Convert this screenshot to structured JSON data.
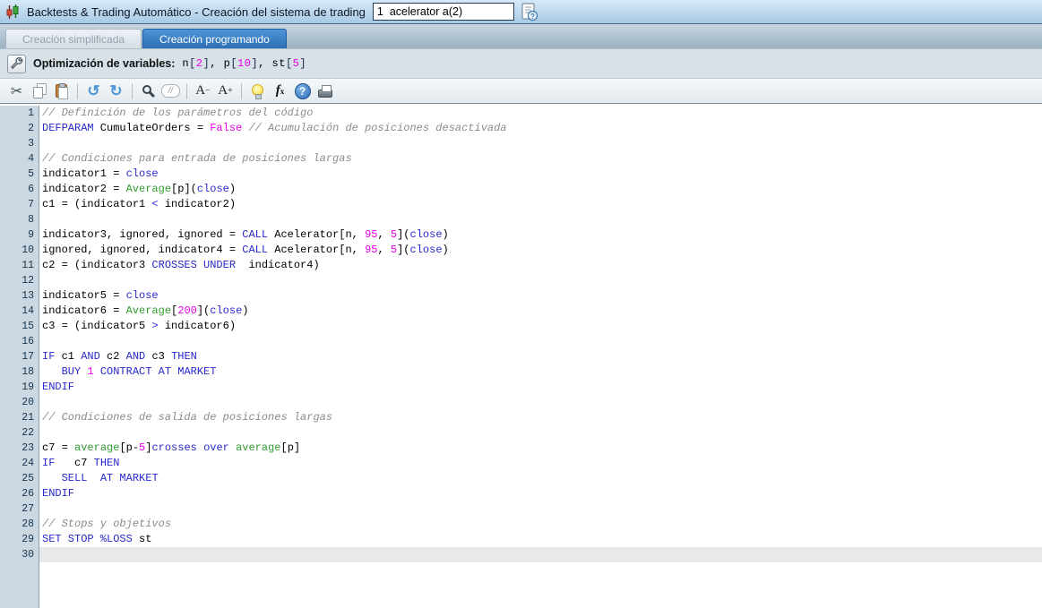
{
  "window": {
    "title": "Backtests & Trading Automático - Creación del sistema de trading",
    "input_value": "1  acelerator a(2)"
  },
  "tabs": [
    {
      "label": "Creación simplificada",
      "active": false
    },
    {
      "label": "Creación programando",
      "active": true
    }
  ],
  "optimization": {
    "label": "Optimización de variables:",
    "variables": [
      {
        "name": "n",
        "value": "2"
      },
      {
        "name": "p",
        "value": "10"
      },
      {
        "name": "st",
        "value": "5"
      }
    ],
    "tokens": [
      [
        "p",
        "n"
      ],
      [
        "b",
        "["
      ],
      [
        "n",
        "2"
      ],
      [
        "b",
        "]"
      ],
      [
        "p",
        ", p"
      ],
      [
        "b",
        "["
      ],
      [
        "n",
        "10"
      ],
      [
        "b",
        "]"
      ],
      [
        "p",
        ", st"
      ],
      [
        "b",
        "["
      ],
      [
        "n",
        "5"
      ],
      [
        "b",
        "]"
      ]
    ]
  },
  "toolbar": {
    "items": [
      {
        "name": "cut",
        "glyph": "✂",
        "cls": "ic-cut"
      },
      {
        "name": "copy",
        "shape": "shape-copy"
      },
      {
        "name": "paste",
        "shape": "shape-paste"
      },
      {
        "name": "sep"
      },
      {
        "name": "undo",
        "glyph": "↺",
        "cls": "ic-undo"
      },
      {
        "name": "redo",
        "glyph": "↻",
        "cls": "ic-redo"
      },
      {
        "name": "sep"
      },
      {
        "name": "search",
        "shape": "shape-search"
      },
      {
        "name": "comment",
        "glyph": "//",
        "cls": "ic-comment-b",
        "boxed": true
      },
      {
        "name": "sep"
      },
      {
        "name": "font-decrease",
        "glyph": "A",
        "sup": "−",
        "cls": "ic-fontdec"
      },
      {
        "name": "font-increase",
        "glyph": "A",
        "sup": "+",
        "cls": "ic-fontinc"
      },
      {
        "name": "sep"
      },
      {
        "name": "hint",
        "shape": "shape-bulb"
      },
      {
        "name": "insert-function",
        "glyph": "f",
        "sub": "x",
        "cls": "ic-fx"
      },
      {
        "name": "help",
        "glyph": "?",
        "cls": "ic-help-c",
        "boxed": true
      },
      {
        "name": "print",
        "shape": "shape-print"
      }
    ]
  },
  "editor": {
    "current_line": 30,
    "lines": [
      [
        [
          "c",
          "// Definición de los parámetros del código"
        ]
      ],
      [
        [
          "k",
          "DEFPARAM"
        ],
        [
          "p",
          " CumulateOrders = "
        ],
        [
          "n",
          "False"
        ],
        [
          "p",
          " "
        ],
        [
          "c",
          "// Acumulación de posiciones desactivada"
        ]
      ],
      [],
      [
        [
          "c",
          "// Condiciones para entrada de posiciones largas"
        ]
      ],
      [
        [
          "p",
          "indicator1 = "
        ],
        [
          "k",
          "close"
        ]
      ],
      [
        [
          "p",
          "indicator2 = "
        ],
        [
          "f",
          "Average"
        ],
        [
          "p",
          "[p]("
        ],
        [
          "k",
          "close"
        ],
        [
          "p",
          ")"
        ]
      ],
      [
        [
          "p",
          "c1 = (indicator1 "
        ],
        [
          "k",
          "<"
        ],
        [
          "p",
          " indicator2)"
        ]
      ],
      [],
      [
        [
          "p",
          "indicator3, ignored, ignored = "
        ],
        [
          "k",
          "CALL"
        ],
        [
          "p",
          " Acelerator[n, "
        ],
        [
          "n",
          "95"
        ],
        [
          "p",
          ", "
        ],
        [
          "n",
          "5"
        ],
        [
          "p",
          "]("
        ],
        [
          "k",
          "close"
        ],
        [
          "p",
          ")"
        ]
      ],
      [
        [
          "p",
          "ignored, ignored, indicator4 = "
        ],
        [
          "k",
          "CALL"
        ],
        [
          "p",
          " Acelerator[n, "
        ],
        [
          "n",
          "95"
        ],
        [
          "p",
          ", "
        ],
        [
          "n",
          "5"
        ],
        [
          "p",
          "]("
        ],
        [
          "k",
          "close"
        ],
        [
          "p",
          ")"
        ]
      ],
      [
        [
          "p",
          "c2 = (indicator3 "
        ],
        [
          "k",
          "CROSSES UNDER"
        ],
        [
          "p",
          "  indicator4)"
        ]
      ],
      [],
      [
        [
          "p",
          "indicator5 = "
        ],
        [
          "k",
          "close"
        ]
      ],
      [
        [
          "p",
          "indicator6 = "
        ],
        [
          "f",
          "Average"
        ],
        [
          "p",
          "["
        ],
        [
          "n",
          "200"
        ],
        [
          "p",
          "]("
        ],
        [
          "k",
          "close"
        ],
        [
          "p",
          ")"
        ]
      ],
      [
        [
          "p",
          "c3 = (indicator5 "
        ],
        [
          "k",
          ">"
        ],
        [
          "p",
          " indicator6)"
        ]
      ],
      [],
      [
        [
          "k",
          "IF"
        ],
        [
          "p",
          " c1 "
        ],
        [
          "k",
          "AND"
        ],
        [
          "p",
          " c2 "
        ],
        [
          "k",
          "AND"
        ],
        [
          "p",
          " c3 "
        ],
        [
          "k",
          "THEN"
        ]
      ],
      [
        [
          "p",
          "   "
        ],
        [
          "k",
          "BUY"
        ],
        [
          "p",
          " "
        ],
        [
          "n",
          "1"
        ],
        [
          "p",
          " "
        ],
        [
          "k",
          "CONTRACT AT MARKET"
        ]
      ],
      [
        [
          "k",
          "ENDIF"
        ]
      ],
      [],
      [
        [
          "c",
          "// Condiciones de salida de posiciones largas"
        ]
      ],
      [],
      [
        [
          "p",
          "c7 = "
        ],
        [
          "f",
          "average"
        ],
        [
          "p",
          "[p-"
        ],
        [
          "n",
          "5"
        ],
        [
          "p",
          "]"
        ],
        [
          "k",
          "crosses over"
        ],
        [
          "p",
          " "
        ],
        [
          "f",
          "average"
        ],
        [
          "p",
          "[p]"
        ]
      ],
      [
        [
          "k",
          "IF"
        ],
        [
          "p",
          "   c7 "
        ],
        [
          "k",
          "THEN"
        ]
      ],
      [
        [
          "p",
          "   "
        ],
        [
          "k",
          "SELL"
        ],
        [
          "p",
          "  "
        ],
        [
          "k",
          "AT MARKET"
        ]
      ],
      [
        [
          "k",
          "ENDIF"
        ]
      ],
      [],
      [
        [
          "c",
          "// Stops y objetivos"
        ]
      ],
      [
        [
          "k",
          "SET STOP %LOSS"
        ],
        [
          "p",
          " st"
        ]
      ],
      []
    ]
  },
  "colors": {
    "keyword": "#2828cc",
    "function": "#2f9b2f",
    "number": "#e800e8",
    "comment": "#8b8b8b",
    "active_tab": "#2d6db5",
    "titlebar": "#a8c9e4",
    "gutter": "#cbd8e2",
    "current_line": "#e9e9e9"
  }
}
